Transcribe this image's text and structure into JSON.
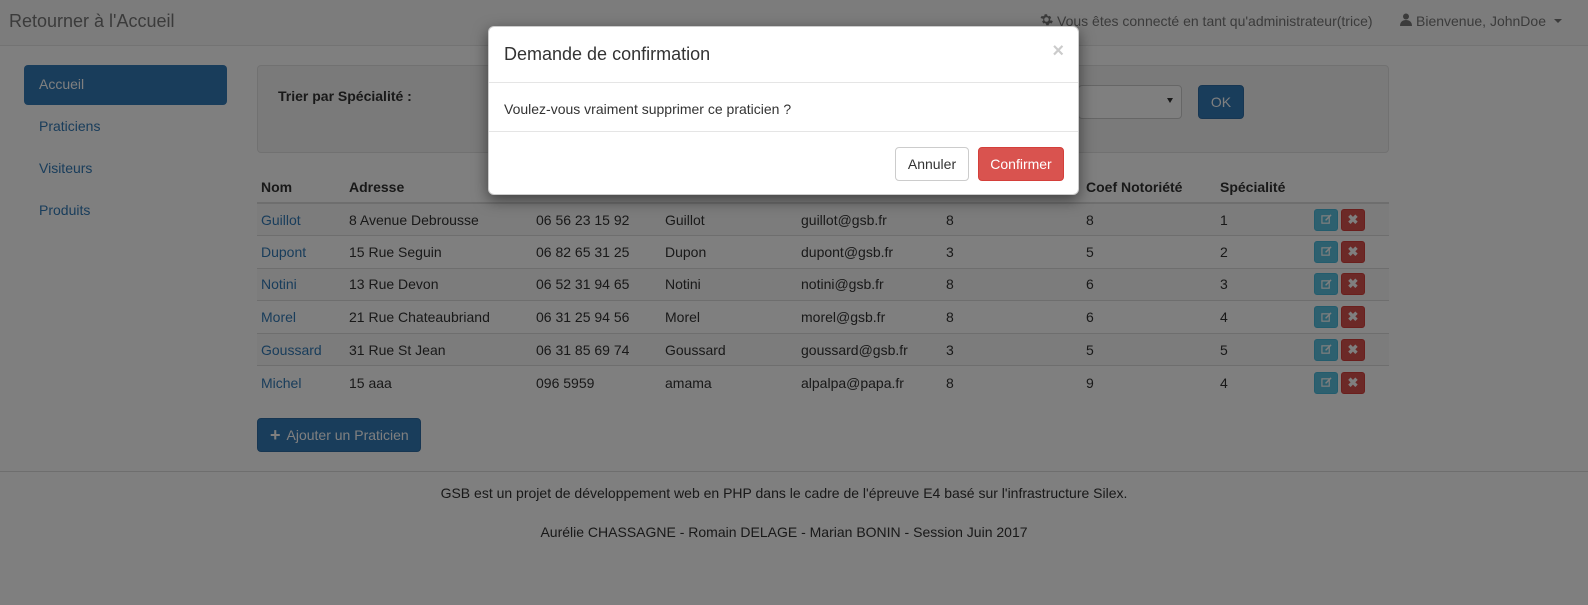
{
  "navbar": {
    "brand": "Retourner à l'Accueil",
    "admin_text": "Vous êtes connecté en tant qu'administrateur(trice)",
    "user_text": "Bienvenue, JohnDoe"
  },
  "sidebar": {
    "items": [
      {
        "label": "Accueil"
      },
      {
        "label": "Praticiens"
      },
      {
        "label": "Visiteurs"
      },
      {
        "label": "Produits"
      }
    ]
  },
  "filter": {
    "label": "Trier par Spécialité :",
    "ok_label": "OK"
  },
  "table": {
    "headers": [
      "Nom",
      "Adresse",
      "",
      "",
      "",
      "",
      "Coef Notoriété",
      "Spécialité",
      ""
    ],
    "rows": [
      [
        "Guillot",
        "8 Avenue Debrousse",
        "06 56 23 15 92",
        "Guillot",
        "guillot@gsb.fr",
        "8",
        "8",
        "1"
      ],
      [
        "Dupont",
        "15 Rue Seguin",
        "06 82 65 31 25",
        "Dupon",
        "dupont@gsb.fr",
        "3",
        "5",
        "2"
      ],
      [
        "Notini",
        "13 Rue Devon",
        "06 52 31 94 65",
        "Notini",
        "notini@gsb.fr",
        "8",
        "6",
        "3"
      ],
      [
        "Morel",
        "21 Rue Chateaubriand",
        "06 31 25 94 56",
        "Morel",
        "morel@gsb.fr",
        "8",
        "6",
        "4"
      ],
      [
        "Goussard",
        "31 Rue St Jean",
        "06 31 85 69 74",
        "Goussard",
        "goussard@gsb.fr",
        "3",
        "5",
        "5"
      ],
      [
        "Michel",
        "15 aaa",
        "096 5959",
        "amama",
        "alpalpa@papa.fr",
        "8",
        "9",
        "4"
      ]
    ]
  },
  "add_button": "Ajouter un Praticien",
  "footer": {
    "line1": "GSB est un projet de développement web en PHP dans le cadre de l'épreuve E4 basé sur l'infrastructure Silex.",
    "line2": "Aurélie CHASSAGNE - Romain DELAGE - Marian BONIN - Session Juin 2017"
  },
  "modal": {
    "title": "Demande de confirmation",
    "close": "×",
    "body": "Voulez-vous vraiment supprimer ce praticien ?",
    "cancel": "Annuler",
    "confirm": "Confirmer"
  },
  "icons": {
    "gear": "gear-icon",
    "user": "user-icon",
    "edit": "edit-icon",
    "delete": "delete-icon",
    "plus": "plus-icon"
  },
  "colors": {
    "primary": "#337ab7",
    "danger": "#d9534f",
    "info": "#5bc0de"
  }
}
